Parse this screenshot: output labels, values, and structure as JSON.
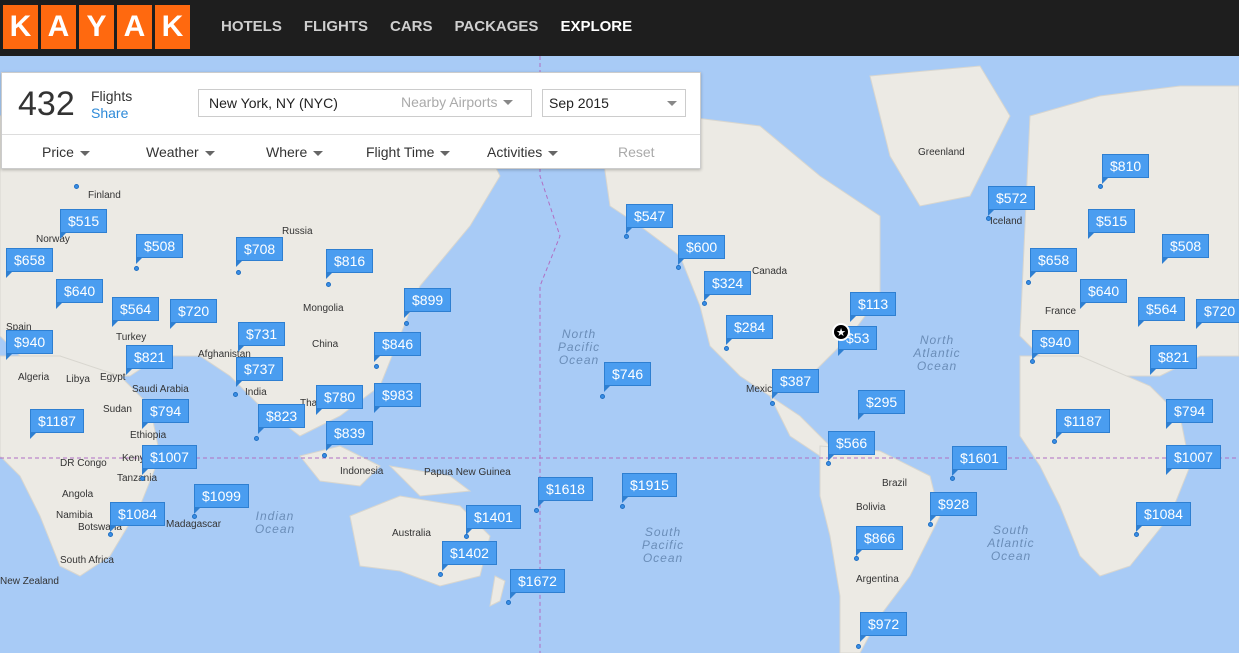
{
  "logo": {
    "letters": [
      "K",
      "A",
      "Y",
      "A",
      "K"
    ],
    "brand_color": "#ff690f"
  },
  "nav": {
    "items": [
      "HOTELS",
      "FLIGHTS",
      "CARS",
      "PACKAGES",
      "EXPLORE"
    ],
    "active": "EXPLORE"
  },
  "panel": {
    "count": "432",
    "count_label": "Flights",
    "share_label": "Share",
    "origin_value": "New York, NY (NYC)",
    "nearby_label": "Nearby Airports",
    "date_value": "Sep 2015",
    "filters": [
      "Price",
      "Weather",
      "Where",
      "Flight Time",
      "Activities"
    ],
    "reset_label": "Reset"
  },
  "places": [
    "Finland",
    "Norway",
    "Russia",
    "Mongolia",
    "China",
    "Afghanistan",
    "India",
    "Turkey",
    "Spain",
    "Algeria",
    "Libya",
    "Egypt",
    "Saudi Arabia",
    "Sudan",
    "Ethiopia",
    "Kenya",
    "Tanzania",
    "DR Congo",
    "Angola",
    "Namibia",
    "Botswana",
    "South Africa",
    "Madagascar",
    "Thailand",
    "Indonesia",
    "Papua New Guinea",
    "Australia",
    "New Zealand",
    "Mexico",
    "Brazil",
    "Bolivia",
    "Argentina",
    "Canada",
    "Greenland",
    "Iceland",
    "France"
  ],
  "oceans": [
    "North Pacific Ocean",
    "North Atlantic Ocean",
    "South Pacific Ocean",
    "South Atlantic Ocean",
    "Indian Ocean"
  ],
  "prices": [
    "$515",
    "$508",
    "$708",
    "$816",
    "$658",
    "$640",
    "$564",
    "$720",
    "$899",
    "$731",
    "$846",
    "$940",
    "$821",
    "$737",
    "$780",
    "$983",
    "$794",
    "$823",
    "$1187",
    "$839",
    "$1007",
    "$1099",
    "$1084",
    "$547",
    "$600",
    "$324",
    "$284",
    "$113",
    "$53",
    "$387",
    "$746",
    "$295",
    "$566",
    "$1601",
    "$1618",
    "$1915",
    "$1401",
    "$1402",
    "$1672",
    "$928",
    "$866",
    "$972",
    "$810",
    "$572",
    "$515",
    "$508",
    "$658",
    "$640",
    "$564",
    "$720",
    "$940",
    "$821",
    "$1187",
    "$794",
    "$1007",
    "$1084"
  ],
  "home_icon": "star-icon"
}
